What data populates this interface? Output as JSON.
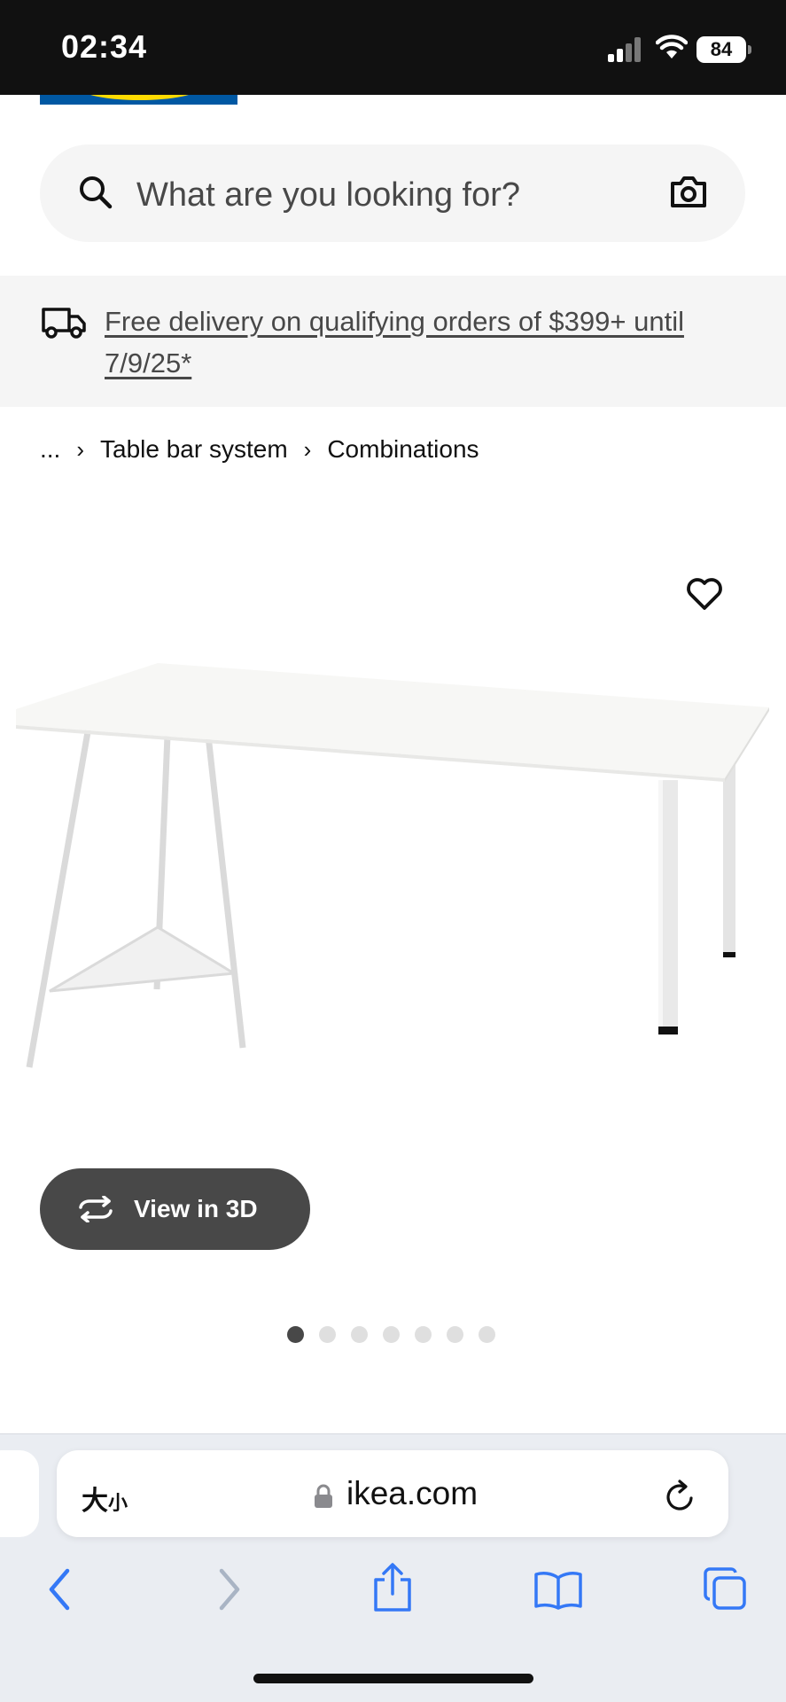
{
  "status_bar": {
    "time": "02:34",
    "battery": "84"
  },
  "search": {
    "placeholder": "What are you looking for?"
  },
  "delivery": {
    "text": "Free delivery on qualifying orders of $399+ until 7/9/25*"
  },
  "breadcrumb": {
    "items": [
      "...",
      "Table bar system",
      "Combinations"
    ]
  },
  "product": {
    "view3d_label": "View in 3D",
    "image_count": 7,
    "active_image": 1
  },
  "browser": {
    "text_size_label": "大",
    "text_size_small": "小",
    "url": "ikea.com"
  },
  "colors": {
    "ikea_blue": "#0058a3",
    "ikea_yellow": "#ffdb00",
    "ios_blue": "#3478f6"
  }
}
